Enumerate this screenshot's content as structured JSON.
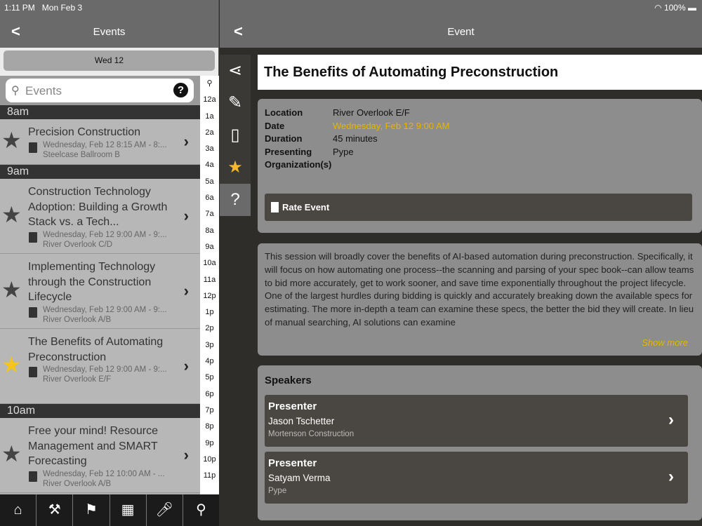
{
  "status": {
    "time": "1:11 PM   Mon Feb 3",
    "battery": "100%"
  },
  "left": {
    "title": "Events",
    "date_tab": "Wed 12",
    "search_placeholder": "Events",
    "index": [
      "12a",
      "1a",
      "2a",
      "3a",
      "4a",
      "5a",
      "6a",
      "7a",
      "8a",
      "9a",
      "10a",
      "11a",
      "12p",
      "1p",
      "2p",
      "3p",
      "4p",
      "5p",
      "6p",
      "7p",
      "8p",
      "9p",
      "10p",
      "11p"
    ],
    "sections": [
      {
        "label": "8am",
        "events": [
          {
            "title": "Precision Construction",
            "time": "Wednesday, Feb 12 8:15 AM - 8:...",
            "location": "Steelcase Ballroom B",
            "fav": false
          }
        ]
      },
      {
        "label": "9am",
        "events": [
          {
            "title": "Construction Technology Adoption: Building a Growth Stack vs. a Tech...",
            "time": "Wednesday, Feb 12 9:00 AM - 9:...",
            "location": "River Overlook C/D",
            "fav": false
          },
          {
            "title": "Implementing Technology through the Construction Lifecycle",
            "time": "Wednesday, Feb 12 9:00 AM - 9:...",
            "location": "River Overlook A/B",
            "fav": false
          },
          {
            "title": "The Benefits of Automating Preconstruction",
            "time": "Wednesday, Feb 12 9:00 AM - 9:...",
            "location": "River Overlook E/F",
            "fav": true
          }
        ]
      },
      {
        "label": "10am",
        "events": [
          {
            "title": "Free your mind! Resource Management and SMART Forecasting",
            "time": "Wednesday, Feb 12 10:00 AM - ...",
            "location": "River Overlook A/B",
            "fav": false
          }
        ]
      }
    ]
  },
  "right": {
    "title": "Event",
    "event_title": "The Benefits of Automating Preconstruction",
    "details": [
      {
        "k": "Location",
        "v": "River Overlook E/F"
      },
      {
        "k": "Date",
        "v": "Wednesday, Feb 12 9:00 AM"
      },
      {
        "k": "Duration",
        "v": "45 minutes"
      },
      {
        "k": "Presenting Organization(s)",
        "v": "Pype"
      }
    ],
    "rate_label": "Rate Event",
    "description": "This session will broadly cover the benefits of AI-based automation during preconstruction. Specifically, it will focus on how automating one process--the scanning and parsing of your spec book--can allow teams to bid more accurately, get to work sooner, and save time exponentially throughout the project lifecycle. One of the largest hurdles during bidding is quickly and accurately breaking down the available specs for estimating. The more in-depth a team can examine these specs, the better the bid they will create. In lieu of manual searching, AI solutions can examine",
    "show_more": "Show more",
    "speakers_heading": "Speakers",
    "speakers": [
      {
        "role": "Presenter",
        "name": "Jason Tschetter",
        "org": "Mortenson Construction"
      },
      {
        "role": "Presenter",
        "name": "Satyam Verma",
        "org": "Pype"
      }
    ]
  },
  "colors": {
    "accent": "#f5b82e",
    "date": "#e8b400"
  }
}
